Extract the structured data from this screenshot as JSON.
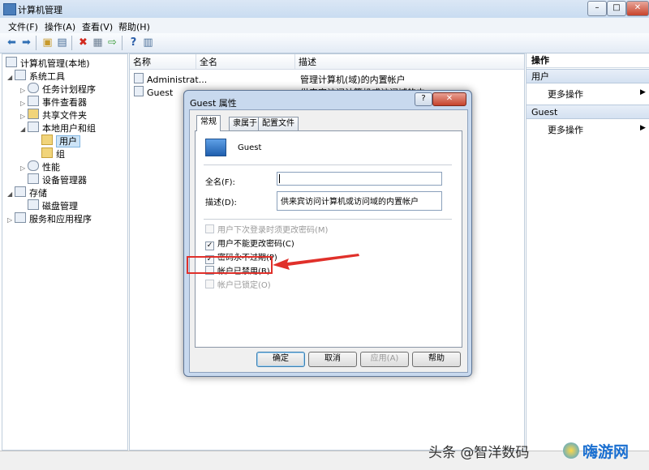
{
  "window": {
    "title": "计算机管理"
  },
  "menu": [
    "文件(F)",
    "操作(A)",
    "查看(V)",
    "帮助(H)"
  ],
  "tree": {
    "root": "计算机管理(本地)",
    "system_tools": "系统工具",
    "task_scheduler": "任务计划程序",
    "event_viewer": "事件查看器",
    "shared_folders": "共享文件夹",
    "local_users": "本地用户和组",
    "users": "用户",
    "groups": "组",
    "performance": "性能",
    "device_manager": "设备管理器",
    "storage": "存储",
    "disk_management": "磁盘管理",
    "services": "服务和应用程序"
  },
  "list": {
    "columns": [
      "名称",
      "全名",
      "描述"
    ],
    "rows": [
      {
        "name": "Administrat...",
        "fullname": "",
        "desc": "管理计算机(域)的内置帐户"
      },
      {
        "name": "Guest",
        "fullname": "",
        "desc": "供来宾访问计算机或访问域的内..."
      }
    ]
  },
  "actions": {
    "header": "操作",
    "section1": "用户",
    "more1": "更多操作",
    "section2": "Guest",
    "more2": "更多操作"
  },
  "dialog": {
    "title": "Guest 属性",
    "help": "?",
    "tabs": [
      "常规",
      "隶属于",
      "配置文件"
    ],
    "username": "Guest",
    "fullname_label": "全名(F):",
    "fullname_value": "",
    "desc_label": "描述(D):",
    "desc_value": "供来宾访问计算机或访问域的内置帐户",
    "checkboxes": [
      {
        "label": "用户下次登录时须更改密码(M)",
        "checked": false,
        "disabled": true
      },
      {
        "label": "用户不能更改密码(C)",
        "checked": true,
        "disabled": false
      },
      {
        "label": "密码永不过期(P)",
        "checked": true,
        "disabled": false
      },
      {
        "label": "帐户已禁用(B)",
        "checked": false,
        "disabled": false
      },
      {
        "label": "帐户已锁定(O)",
        "checked": false,
        "disabled": true
      }
    ],
    "buttons": {
      "ok": "确定",
      "cancel": "取消",
      "apply": "应用(A)",
      "help": "帮助"
    }
  },
  "watermark": {
    "text": "头条 @智洋数码",
    "site": "嗨游网"
  },
  "colors": {
    "accent": "#3c7fb1",
    "highlight_red": "#e0302a",
    "selection": "#cde4f7"
  }
}
